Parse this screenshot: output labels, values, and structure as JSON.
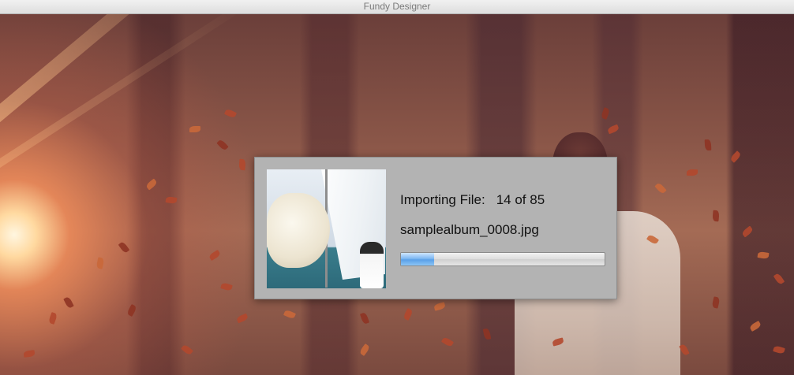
{
  "window": {
    "title": "Fundy Designer"
  },
  "import_dialog": {
    "label": "Importing File:",
    "count": "14 of 85",
    "filename": "samplealbum_0008.jpg",
    "progress_fraction": 0.1647,
    "progress_color": "#5aa0e8"
  }
}
